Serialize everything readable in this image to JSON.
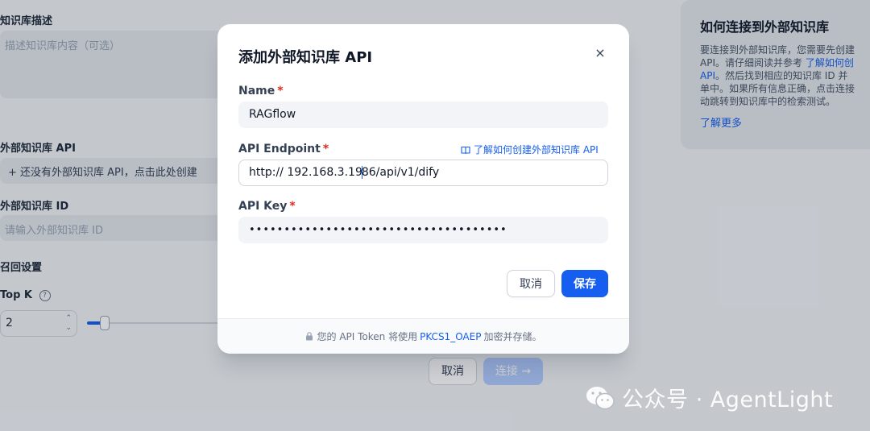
{
  "background": {
    "description_label": "知识库描述",
    "description_placeholder": "描述知识库内容（可选）",
    "api_label": "外部知识库 API",
    "api_select_text": "+ 还没有外部知识库 API，点击此处创建",
    "id_label": "外部知识库 ID",
    "id_placeholder": "请输入外部知识库 ID",
    "retrieval_label": "召回设置",
    "topk_label": "Top K",
    "topk_value": "2",
    "topk_slider_fraction": 0.12,
    "cancel_label": "取消",
    "connect_label": "连接 →",
    "help": {
      "title": "如何连接到外部知识库",
      "line1": "要连接到外部知识库，您需要先创建",
      "line2_a": "API。请仔细阅读并参考 ",
      "line2_link": "了解如何创",
      "line3_link": "API",
      "line3_b": "。然后找到相应的知识库 ID 并",
      "line4": "单中。如果所有信息正确，点击连接",
      "line5": "动跳转到知识库中的检索测试。",
      "more_link": "了解更多"
    }
  },
  "modal": {
    "title": "添加外部知识库 API",
    "close_icon": "×",
    "name_label": "Name",
    "name_value": "RAGflow",
    "endpoint_label": "API Endpoint",
    "endpoint_help_link": "了解如何创建外部知识库 API",
    "endpoint_value_before_caret": "http:// 192.168.3.19",
    "endpoint_value_after_caret": "86/api/v1/dify",
    "key_label": "API Key",
    "key_value_masked": "•••••••••••••••••••••••••••••••••••••",
    "required_mark": "*",
    "cancel_label": "取消",
    "save_label": "保存",
    "footer_prefix": "您的 API Token 将使用",
    "footer_link": "PKCS1_OAEP",
    "footer_suffix": "加密并存储。"
  },
  "watermark": {
    "text": "公众号 · AgentLight"
  },
  "colors": {
    "accent": "#155eef",
    "required": "#d92d20"
  }
}
